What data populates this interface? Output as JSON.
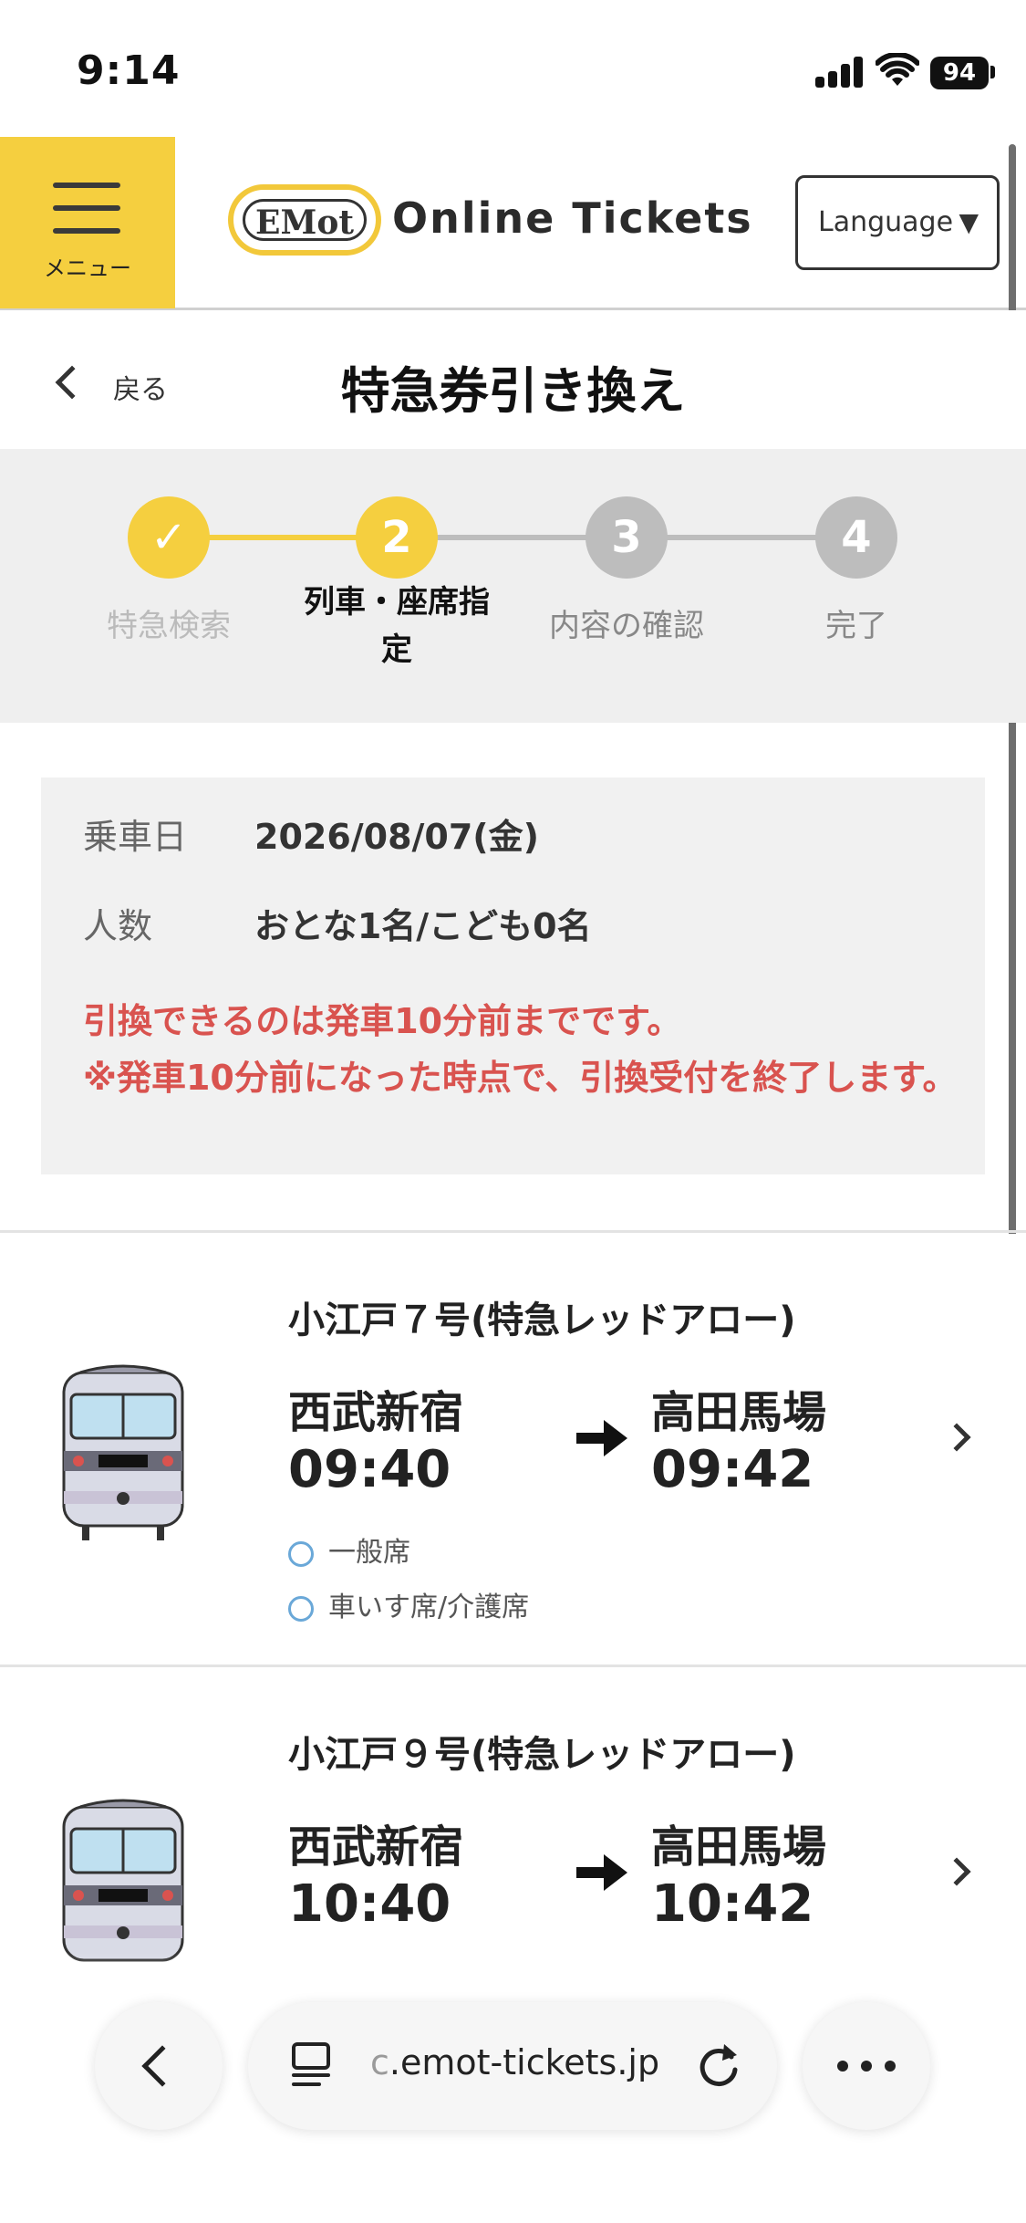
{
  "status_bar": {
    "time": "9:14",
    "battery": "94"
  },
  "header": {
    "menu_label": "メニュー",
    "logo_badge": "EMot",
    "logo_text": "Online Tickets",
    "language_label": "Language",
    "language_arrow": "▼"
  },
  "nav": {
    "back_label": "戻る",
    "page_title": "特急券引き換え"
  },
  "stepper": {
    "steps": [
      {
        "num": "✓",
        "label": "特急検索",
        "state": "done"
      },
      {
        "num": "2",
        "label": "列車・座席指定",
        "state": "current"
      },
      {
        "num": "3",
        "label": "内容の確認",
        "state": "upcoming"
      },
      {
        "num": "4",
        "label": "完了",
        "state": "upcoming"
      }
    ]
  },
  "info": {
    "date_label": "乗車日",
    "date_value": "2026/08/07(金)",
    "people_label": "人数",
    "people_value": "おとな1名/こども0名",
    "notice_1": "引換できるのは発車10分前までです。",
    "notice_2": "※発車10分前になった時点で、引換受付を終了します。"
  },
  "trains": [
    {
      "name": "小江戸７号(特急レッドアロー)",
      "from": "西武新宿",
      "dep": "09:40",
      "to": "高田馬場",
      "arr": "09:42",
      "seats": [
        "一般席",
        "車いす席/介護席"
      ]
    },
    {
      "name": "小江戸９号(特急レッドアロー)",
      "from": "西武新宿",
      "dep": "10:40",
      "to": "高田馬場",
      "arr": "10:42",
      "seats": []
    }
  ],
  "browser": {
    "url_prefix": "c",
    "url": ".emot-tickets.jp"
  },
  "colors": {
    "accent": "#f5cf3f",
    "notice": "#d9534f",
    "step_inactive": "#bdbdbd",
    "radio": "#6aa8d8"
  }
}
